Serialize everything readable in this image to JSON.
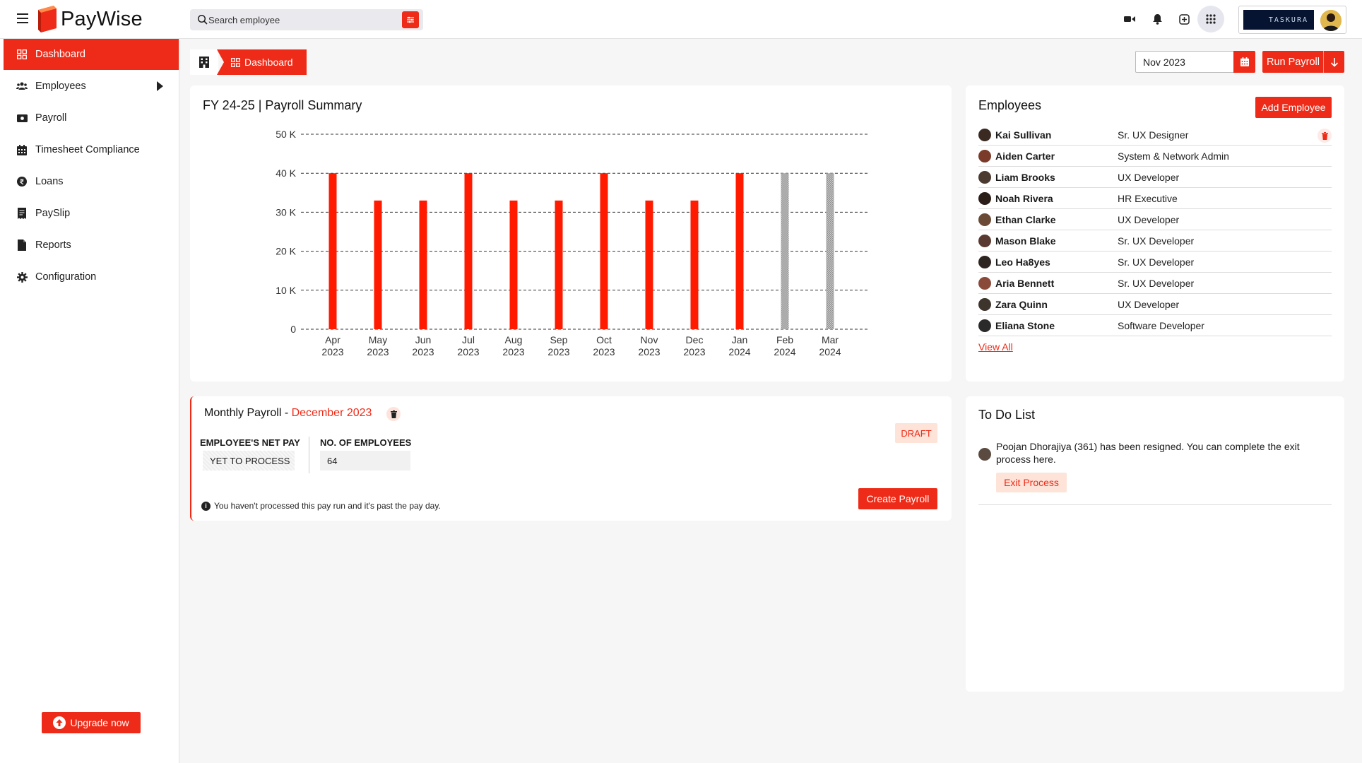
{
  "brand": {
    "name": "PayWise",
    "partner_logo_text": "TASKURA"
  },
  "search": {
    "placeholder": "Search employee"
  },
  "sidebar": {
    "items": [
      {
        "label": "Dashboard",
        "icon": "grid-icon",
        "active": true
      },
      {
        "label": "Employees",
        "icon": "users-icon"
      },
      {
        "label": "Payroll",
        "icon": "money-icon"
      },
      {
        "label": "Timesheet Compliance",
        "icon": "calendar-icon"
      },
      {
        "label": "Loans",
        "icon": "rupee-icon"
      },
      {
        "label": "PaySlip",
        "icon": "receipt-icon"
      },
      {
        "label": "Reports",
        "icon": "file-icon"
      },
      {
        "label": "Configuration",
        "icon": "gear-icon"
      }
    ],
    "upgrade_label": "Upgrade now"
  },
  "breadcrumb": {
    "current": "Dashboard"
  },
  "toolbar": {
    "month_value": "Nov 2023",
    "run_payroll_label": "Run Payroll"
  },
  "payroll_summary": {
    "title": "FY 24-25 | Payroll Summary"
  },
  "chart_data": {
    "type": "bar",
    "title": "FY 24-25 | Payroll Summary",
    "categories": [
      "Apr 2023",
      "May 2023",
      "Jun 2023",
      "Jul 2023",
      "Aug 2023",
      "Sep 2023",
      "Oct 2023",
      "Nov 2023",
      "Dec 2023",
      "Jan 2024",
      "Feb 2024",
      "Mar 2024"
    ],
    "values": [
      40000,
      33000,
      33000,
      40000,
      33000,
      33000,
      40000,
      33000,
      33000,
      40000,
      40000,
      40000
    ],
    "projected": [
      false,
      false,
      false,
      false,
      false,
      false,
      false,
      false,
      false,
      false,
      true,
      true
    ],
    "ylim": [
      0,
      50000
    ],
    "yticks": [
      "0",
      "10 K",
      "20 K",
      "30 K",
      "40 K",
      "50 K"
    ],
    "grid": true,
    "colors": {
      "actual": "#ff1a00",
      "projected": "#8f8f8f"
    }
  },
  "employees": {
    "title": "Employees",
    "add_label": "Add Employee",
    "view_all_label": "View All",
    "rows": [
      {
        "name": "Kai Sullivan",
        "role": "Sr. UX Designer"
      },
      {
        "name": "Aiden Carter",
        "role": "System & Network Admin"
      },
      {
        "name": "Liam Brooks",
        "role": "UX Developer"
      },
      {
        "name": "Noah Rivera",
        "role": "HR Executive"
      },
      {
        "name": "Ethan Clarke",
        "role": "UX Developer"
      },
      {
        "name": "Mason Blake",
        "role": "Sr. UX Developer"
      },
      {
        "name": "Leo Ha8yes",
        "role": "Sr. UX Developer"
      },
      {
        "name": "Aria Bennett",
        "role": "Sr. UX Developer"
      },
      {
        "name": "Zara Quinn",
        "role": "UX Developer"
      },
      {
        "name": "Eliana Stone",
        "role": "Software Developer"
      }
    ]
  },
  "monthly_payroll": {
    "title_prefix": "Monthly Payroll - ",
    "month": "December 2023",
    "net_pay_label": "EMPLOYEE'S NET PAY",
    "net_pay_value": "YET TO PROCESS",
    "employees_label": "NO. OF EMPLOYEES",
    "employees_value": "64",
    "status": "DRAFT",
    "create_label": "Create Payroll",
    "note": "You haven't processed this pay run and it's past the pay day."
  },
  "todo": {
    "title": "To Do List",
    "items": [
      {
        "text": "Poojan Dhorajiya (361) has been resigned. You can complete the exit process here.",
        "action": "Exit Process"
      }
    ]
  }
}
